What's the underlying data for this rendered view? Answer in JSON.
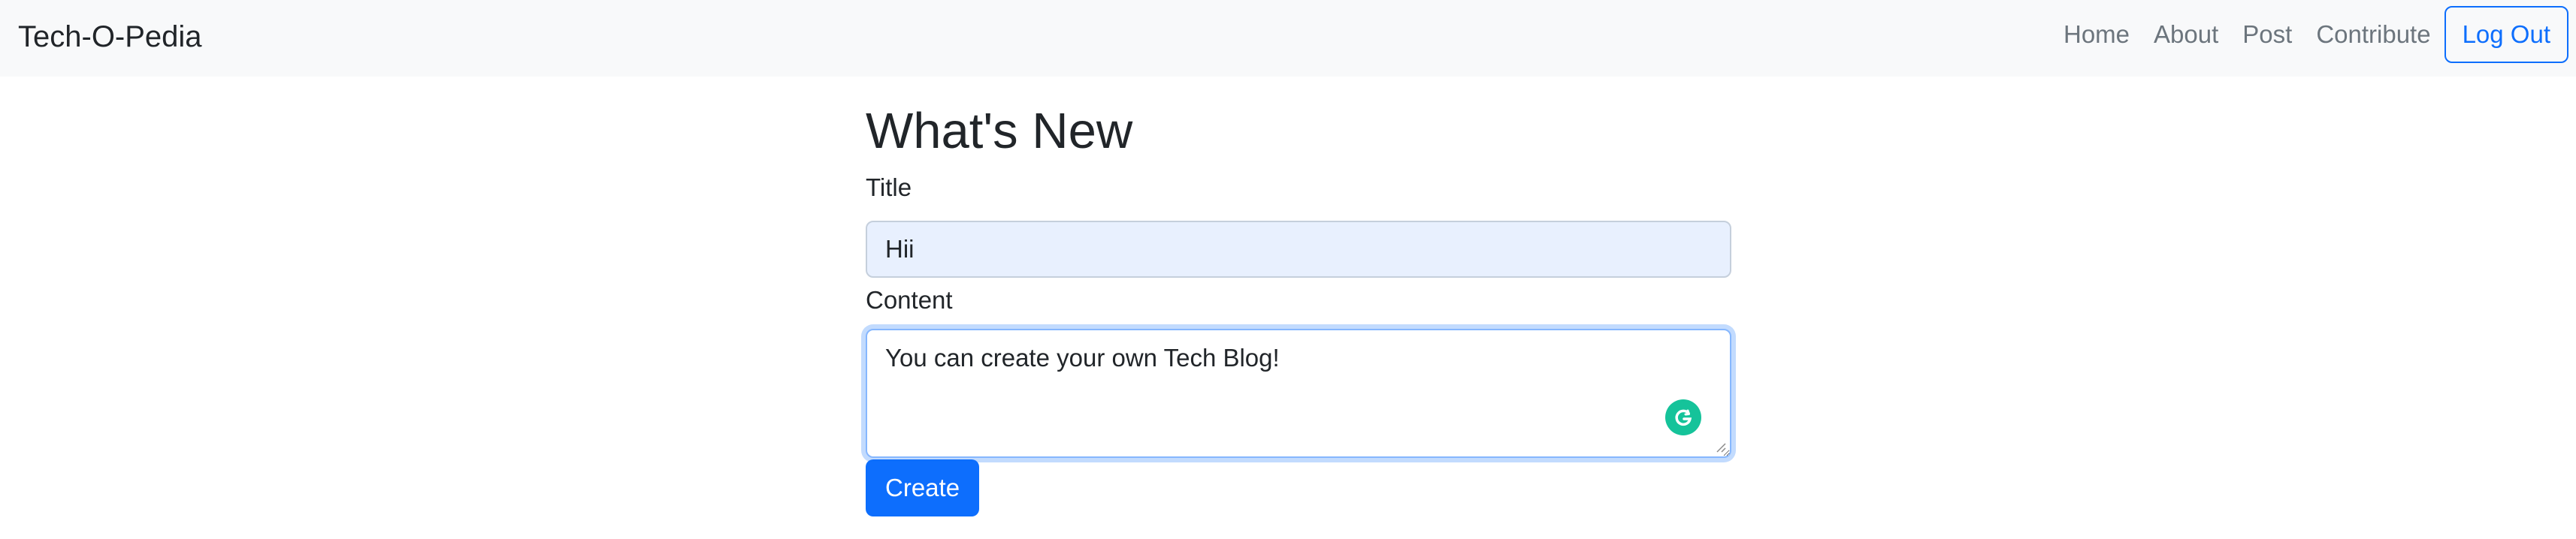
{
  "navbar": {
    "brand": "Tech-O-Pedia",
    "links": [
      "Home",
      "About",
      "Post",
      "Contribute"
    ],
    "logout_label": "Log Out"
  },
  "main": {
    "heading": "What's New",
    "title_label": "Title",
    "title_value": "Hii",
    "content_label": "Content",
    "content_value": "You can create your own Tech Blog!",
    "create_label": "Create"
  },
  "icons": {
    "grammarly": "grammarly-icon",
    "resize": "resize-handle-icon"
  },
  "colors": {
    "navbar_bg": "#f8f9fa",
    "primary": "#0d6efd",
    "autofill_bg": "#e8f0fe",
    "grammarly": "#15c39a"
  }
}
